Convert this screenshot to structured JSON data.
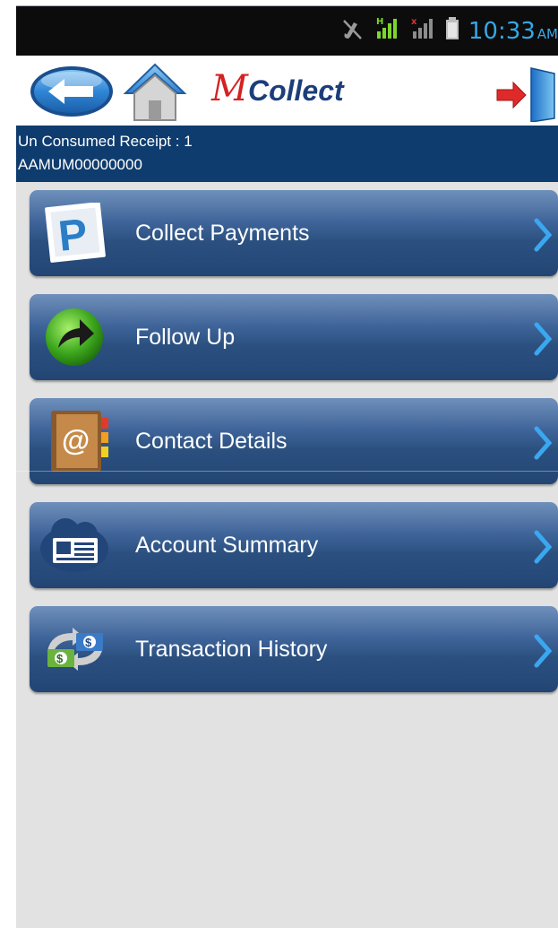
{
  "status_bar": {
    "time": "10:33",
    "ampm": "AM",
    "icons": [
      "mute-icon",
      "signal-h-icon",
      "signal-no-sim-icon",
      "battery-icon"
    ]
  },
  "header": {
    "logo_m": "M",
    "logo_text": "Collect",
    "back_icon": "back-arrow-icon",
    "home_icon": "home-icon",
    "exit_icon": "exit-door-icon"
  },
  "info": {
    "receipt_line": "Un Consumed Receipt : 1",
    "account_code": "AAMUM00000000"
  },
  "menu": {
    "items": [
      {
        "label": "Collect Payments",
        "icon": "payment-stamp-icon"
      },
      {
        "label": "Follow Up",
        "icon": "follow-up-arrow-icon"
      },
      {
        "label": "Contact Details",
        "icon": "address-book-icon"
      },
      {
        "label": "Account Summary",
        "icon": "id-card-icon"
      },
      {
        "label": "Transaction History",
        "icon": "money-exchange-icon"
      }
    ]
  },
  "colors": {
    "status_bar": "#0c0c0c",
    "status_text": "#35a8e6",
    "info_bar": "#0f3c6e",
    "menu_button": "#2b5080",
    "logo_red": "#d32222",
    "logo_blue": "#1c3e7a",
    "background": "#e2e2e2"
  }
}
